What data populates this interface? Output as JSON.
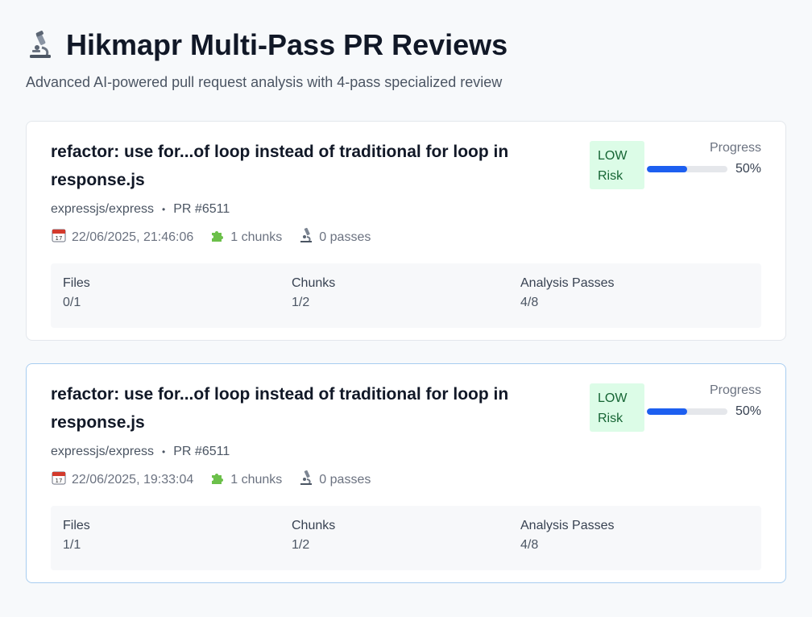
{
  "header": {
    "title": "Hikmapr Multi-Pass PR Reviews",
    "subtitle": "Advanced AI-powered pull request analysis with 4-pass specialized review",
    "icon": "microscope-icon"
  },
  "reviews": [
    {
      "title": "refactor: use for...of loop instead of traditional for loop in response.js",
      "repo": "expressjs/express",
      "pr": "PR #6511",
      "date": "22/06/2025, 21:46:06",
      "chunks": "1 chunks",
      "passes": "0 passes",
      "risk_level": "LOW",
      "risk_suffix": "Risk",
      "progress_label": "Progress",
      "progress_percent": 50,
      "progress_text": "50%",
      "stats": [
        {
          "label": "Files",
          "value": "0/1"
        },
        {
          "label": "Chunks",
          "value": "1/2"
        },
        {
          "label": "Analysis Passes",
          "value": "4/8"
        }
      ]
    },
    {
      "title": "refactor: use for...of loop instead of traditional for loop in response.js",
      "repo": "expressjs/express",
      "pr": "PR #6511",
      "date": "22/06/2025, 19:33:04",
      "chunks": "1 chunks",
      "passes": "0 passes",
      "risk_level": "LOW",
      "risk_suffix": "Risk",
      "progress_label": "Progress",
      "progress_percent": 50,
      "progress_text": "50%",
      "stats": [
        {
          "label": "Files",
          "value": "1/1"
        },
        {
          "label": "Chunks",
          "value": "1/2"
        },
        {
          "label": "Analysis Passes",
          "value": "4/8"
        }
      ]
    }
  ],
  "colors": {
    "accent": "#1d5ff0",
    "risk_low_bg": "#dcfce7",
    "risk_low_text": "#166534"
  }
}
